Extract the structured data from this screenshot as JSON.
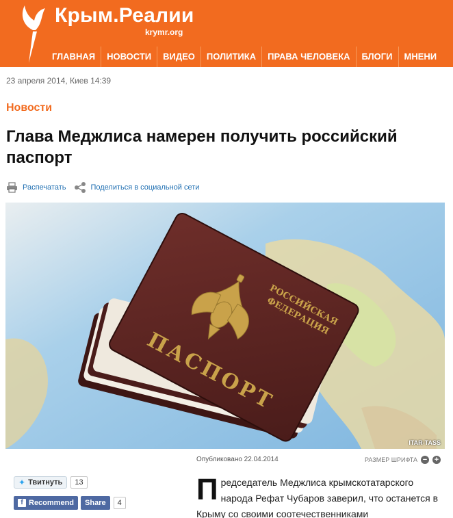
{
  "site": {
    "title": "Крым.Реалии",
    "domain": "krymr.org",
    "brand_color": "#f26b1f",
    "logo_icon": "torch-logo-icon"
  },
  "nav": {
    "items": [
      {
        "label": "ГЛАВНАЯ"
      },
      {
        "label": "НОВОСТИ"
      },
      {
        "label": "ВИДЕО"
      },
      {
        "label": "ПОЛИТИКА"
      },
      {
        "label": "ПРАВА ЧЕЛОВЕКА"
      },
      {
        "label": "БЛОГИ"
      },
      {
        "label": "МНЕНИ"
      }
    ]
  },
  "article": {
    "dateline": "23 апреля 2014, Киев 14:39",
    "section": "Новости",
    "headline": "Глава Меджлиса намерен получить российский паспорт",
    "tools": {
      "print_label": "Распечатать",
      "print_icon": "printer-icon",
      "share_label": "Поделиться в социальной сети",
      "share_icon": "share-icon"
    },
    "photo": {
      "cover_lines": [
        "РОССИЙСКАЯ",
        "ФЕДЕРАЦИЯ"
      ],
      "cover_title": "ПАСПОРТ",
      "credit": "ITAR-TASS"
    },
    "published": "Опубликовано 22.04.2014",
    "font_size_label": "РАЗМЕР ШРИФТА",
    "font_minus": "−",
    "font_plus": "+",
    "lead_dropcap": "П",
    "lead_text": "редседатель Меджлиса крымскотатарского народа Рефат Чубаров заверил, что останется в Крыму со своими соотечественниками"
  },
  "social": {
    "tweet_label": "Твитнуть",
    "tweet_count": "13",
    "fb_recommend_label": "Recommend",
    "fb_share_label": "Share",
    "fb_count": "4"
  }
}
